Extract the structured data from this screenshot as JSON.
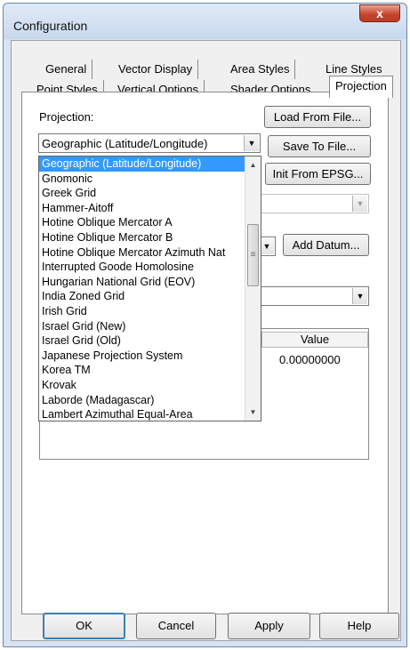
{
  "window": {
    "title": "Configuration",
    "close_glyph": "x"
  },
  "tabs_row1": [
    {
      "label": "General"
    },
    {
      "label": "Vector Display"
    },
    {
      "label": "Area Styles"
    },
    {
      "label": "Line Styles"
    }
  ],
  "tabs_row2": [
    {
      "label": "Point Styles"
    },
    {
      "label": "Vertical Options"
    },
    {
      "label": "Shader Options"
    },
    {
      "label": "Projection",
      "active": true
    }
  ],
  "projection": {
    "label": "Projection:",
    "selected": "Geographic (Latitude/Longitude)",
    "load_button": "Load From File...",
    "save_button": "Save To File...",
    "epsg_button": "Init From EPSG...",
    "add_datum_button": "Add Datum...",
    "options": [
      "Geographic (Latitude/Longitude)",
      "Gnomonic",
      "Greek Grid",
      "Hammer-Aitoff",
      "Hotine Oblique Mercator A",
      "Hotine Oblique Mercator B",
      "Hotine Oblique Mercator Azimuth Nat",
      "Interrupted Goode Homolosine",
      "Hungarian National Grid (EOV)",
      "India Zoned Grid",
      "Irish Grid",
      "Israel Grid (New)",
      "Israel Grid (Old)",
      "Japanese Projection System",
      "Korea TM",
      "Krovak",
      "Laborde (Madagascar)",
      "Lambert Azimuthal Equal-Area"
    ]
  },
  "params_table": {
    "value_header": "Value",
    "value": "0.00000000"
  },
  "footer": {
    "ok": "OK",
    "cancel": "Cancel",
    "apply": "Apply",
    "help": "Help"
  },
  "icons": {
    "dropdown": "chevron-down-icon",
    "scroll_up": "scroll-up-arrow-icon",
    "scroll_down": "scroll-down-arrow-icon",
    "close": "close-icon"
  },
  "colors": {
    "selection": "#3399ff",
    "title_bar": "#d6e3f3",
    "close_button": "#c7452e"
  }
}
